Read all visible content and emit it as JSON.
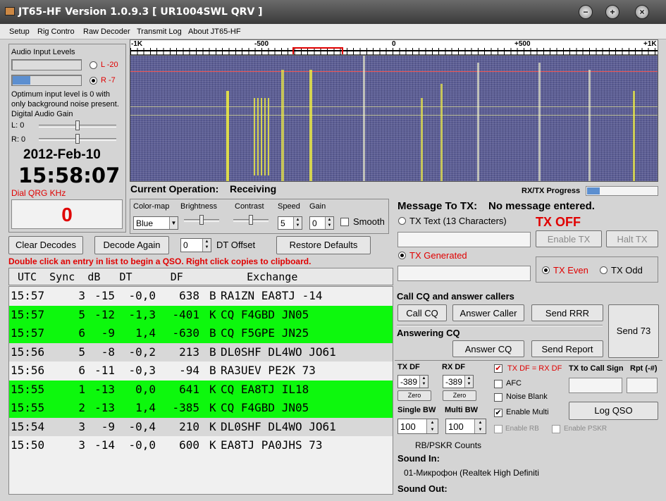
{
  "window": {
    "title": "JT65-HF Version 1.0.9.3  [ UR1004SWL QRV ]"
  },
  "menu": [
    "Setup",
    "Rig Contro",
    "Raw Decoder",
    "Transmit Log",
    "About JT65-HF"
  ],
  "audio": {
    "title": "Audio Input Levels",
    "left_label": "L -20",
    "right_label": "R -7",
    "hint": "Optimum input level is 0 with only background noise present.",
    "gain_title": "Digital Audio Gain",
    "gain_l": "L: 0",
    "gain_r": "R: 0",
    "right_level": 0.26
  },
  "clock": {
    "date": "2012-Feb-10",
    "time": "15:58:07"
  },
  "dial": {
    "label": "Dial QRG KHz",
    "value": "0"
  },
  "scale": {
    "labels": [
      "-1K",
      "-500",
      "0",
      "+500",
      "+1K"
    ]
  },
  "operation": {
    "label": "Current Operation:",
    "value": "Receiving"
  },
  "progress": {
    "label": "RX/TX Progress",
    "value": 0.18
  },
  "waterfall_ctrl": {
    "colormap_label": "Color-map",
    "colormap_value": "Blue",
    "brightness_label": "Brightness",
    "contrast_label": "Contrast",
    "speed_label": "Speed",
    "speed_value": "5",
    "gain_label": "Gain",
    "gain_value": "0",
    "smooth_label": "Smooth"
  },
  "actions": {
    "clear": "Clear Decodes",
    "decode_again": "Decode Again",
    "dt_value": "0",
    "dt_label": "DT Offset",
    "restore": "Restore Defaults"
  },
  "hint": "Double click an entry in list to begin a QSO.  Right click copies to clipboard.",
  "decode_header": "UTC  Sync  dB   DT      DF          Exchange",
  "decodes": [
    {
      "utc": "15:57",
      "sync": "3",
      "db": "-15",
      "dt": "-0,0",
      "df": "638",
      "mode": "B",
      "exchange": "RA1ZN EA8TJ -14",
      "cq": false
    },
    {
      "utc": "15:57",
      "sync": "5",
      "db": "-12",
      "dt": "-1,3",
      "df": "-401",
      "mode": "K",
      "exchange": "CQ F4GBD JN05",
      "cq": true
    },
    {
      "utc": "15:57",
      "sync": "6",
      "db": "-9",
      "dt": "1,4",
      "df": "-630",
      "mode": "B",
      "exchange": "CQ F5GPE JN25",
      "cq": true
    },
    {
      "utc": "15:56",
      "sync": "5",
      "db": "-8",
      "dt": "-0,2",
      "df": "213",
      "mode": "B",
      "exchange": "DL0SHF DL4WO JO61",
      "cq": false
    },
    {
      "utc": "15:56",
      "sync": "6",
      "db": "-11",
      "dt": "-0,3",
      "df": "-94",
      "mode": "B",
      "exchange": "RA3UEV PE2K 73",
      "cq": false
    },
    {
      "utc": "15:55",
      "sync": "1",
      "db": "-13",
      "dt": "0,0",
      "df": "641",
      "mode": "K",
      "exchange": "CQ EA8TJ IL18",
      "cq": true
    },
    {
      "utc": "15:55",
      "sync": "2",
      "db": "-13",
      "dt": "1,4",
      "df": "-385",
      "mode": "K",
      "exchange": "CQ F4GBD JN05",
      "cq": true
    },
    {
      "utc": "15:54",
      "sync": "3",
      "db": "-9",
      "dt": "-0,4",
      "df": "210",
      "mode": "K",
      "exchange": "DL0SHF DL4WO JO61",
      "cq": false
    },
    {
      "utc": "15:50",
      "sync": "3",
      "db": "-14",
      "dt": "-0,0",
      "df": "600",
      "mode": "K",
      "exchange": "EA8TJ PA0JHS 73",
      "cq": false
    }
  ],
  "tx": {
    "message_label": "Message To TX:",
    "message_value": "No message entered.",
    "tx_text_label": "TX Text (13 Characters)",
    "tx_off": "TX OFF",
    "enable_tx": "Enable TX",
    "halt_tx": "Halt TX",
    "tx_generated": "TX Generated",
    "tx_even": "TX Even",
    "tx_odd": "TX Odd"
  },
  "cq": {
    "title": "Call CQ and answer callers",
    "call_cq": "Call CQ",
    "answer_caller": "Answer Caller",
    "send_rrr": "Send RRR",
    "send_73": "Send 73",
    "answering": "Answering CQ",
    "answer_cq": "Answer CQ",
    "send_report": "Send Report"
  },
  "df": {
    "tx_label": "TX DF",
    "tx_value": "-389",
    "rx_label": "RX DF",
    "rx_value": "-389",
    "zero": "Zero",
    "lock": "TX DF = RX DF",
    "afc": "AFC",
    "noise": "Noise Blank",
    "multi": "Enable Multi",
    "rb": "Enable RB",
    "pskr": "Enable PSKR",
    "single_bw": "Single BW",
    "single_value": "100",
    "multi_bw": "Multi BW",
    "multi_value": "100",
    "to_call": "TX to Call Sign",
    "rpt": "Rpt (-#)",
    "log": "Log QSO"
  },
  "counts": "RB/PSKR Counts",
  "sound": {
    "in_label": "Sound In:",
    "in_device": "01-Микрофон (Realtek High Definiti",
    "out_label": "Sound Out:"
  },
  "colors": {
    "cq_row": "#0df80d",
    "waterfall": "#5d5f95",
    "signal": "#f2f040",
    "red": "#e00000"
  }
}
